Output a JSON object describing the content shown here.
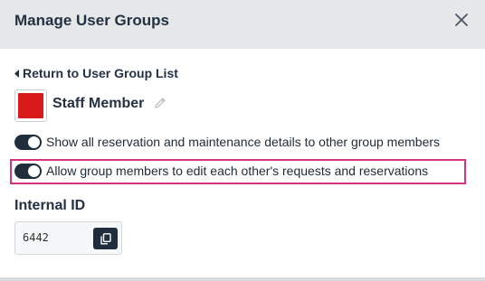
{
  "header": {
    "title": "Manage User Groups",
    "close_icon": "close-icon"
  },
  "back_link": {
    "label": "Return to User Group List",
    "icon": "caret-left-icon"
  },
  "group": {
    "name": "Staff Member",
    "color": "#d91a1a",
    "edit_icon": "pencil-icon"
  },
  "toggles": [
    {
      "label": "Show all reservation and maintenance details to other group members",
      "on": true
    },
    {
      "label": "Allow group members to edit each other's requests and reservations",
      "on": true,
      "highlighted": true
    }
  ],
  "internal_id": {
    "title": "Internal ID",
    "value": "6442",
    "copy_icon": "copy-icon"
  },
  "colors": {
    "header_bg": "#e6e7e8",
    "toggle_on": "#1f2d3d",
    "highlight": "#d6337a"
  }
}
